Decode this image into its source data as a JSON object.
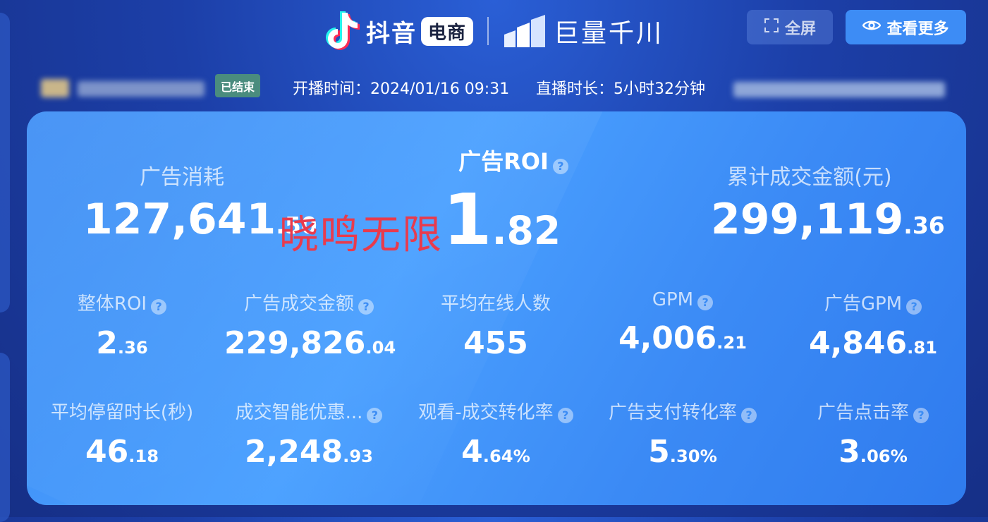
{
  "header": {
    "brand_primary": "抖音",
    "brand_primary_pill": "电商",
    "brand_secondary": "巨量千川",
    "fullscreen_label": "全屏",
    "view_more_label": "查看更多"
  },
  "info": {
    "status_badge": "已结束",
    "start_time_label": "开播时间：",
    "start_time": "2024/01/16 09:31",
    "duration_label": "直播时长：",
    "duration": "5小时32分钟"
  },
  "watermark": "晓鸣无限",
  "top_metrics": {
    "ad_spend": {
      "label": "广告消耗",
      "int": "127,641",
      "dec": ".50"
    },
    "ad_roi": {
      "label": "广告ROI",
      "int": "1",
      "dec": ".82"
    },
    "total_gmv": {
      "label": "累计成交金额(元)",
      "int": "299,119",
      "dec": ".36"
    }
  },
  "row1": [
    {
      "label": "整体ROI",
      "int": "2",
      "dec": ".36",
      "help": true
    },
    {
      "label": "广告成交金额",
      "int": "229,826",
      "dec": ".04",
      "help": true
    },
    {
      "label": "平均在线人数",
      "int": "455",
      "dec": "",
      "help": false
    },
    {
      "label": "GPM",
      "int": "4,006",
      "dec": ".21",
      "help": true
    },
    {
      "label": "广告GPM",
      "int": "4,846",
      "dec": ".81",
      "help": true
    }
  ],
  "row2": [
    {
      "label": "平均停留时长(秒)",
      "int": "46",
      "dec": ".18",
      "help": false
    },
    {
      "label": "成交智能优惠...",
      "int": "2,248",
      "dec": ".93",
      "help": true
    },
    {
      "label": "观看-成交转化率",
      "int": "4",
      "dec": ".64%",
      "help": true
    },
    {
      "label": "广告支付转化率",
      "int": "5",
      "dec": ".30%",
      "help": true
    },
    {
      "label": "广告点击率",
      "int": "3",
      "dec": ".06%",
      "help": true
    }
  ],
  "help_glyph": "?",
  "colors": {
    "panel": "#3d8df4",
    "badge": "#4a8c7e",
    "watermark": "#e83b4d",
    "view_more": "#3d8cf5"
  }
}
